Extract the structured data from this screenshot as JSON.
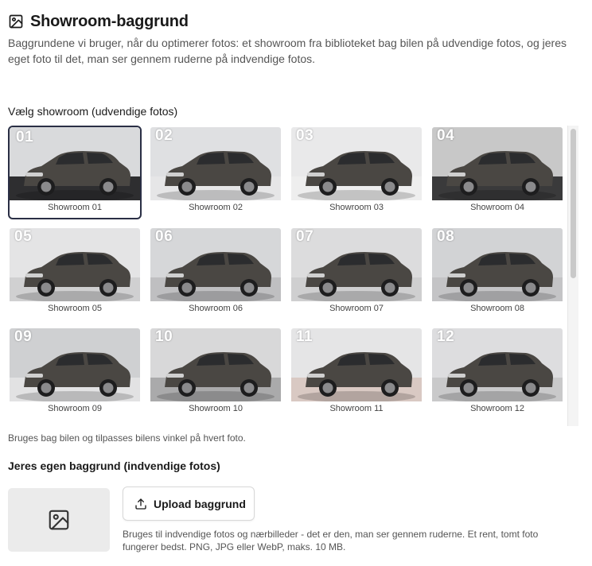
{
  "header": {
    "title": "Showroom-baggrund",
    "description": "Baggrundene vi bruger, når du optimerer fotos: et showroom fra biblioteket bag bilen på udvendige fotos, og jeres eget foto til det, man ser gennem ruderne på indvendige fotos.",
    "icon": "image-icon"
  },
  "showroom_section": {
    "label": "Vælg showroom (udvendige fotos)",
    "selected_index": 0,
    "tiles": [
      {
        "number": "01",
        "caption": "Showroom 01",
        "bg": "#d9dadc",
        "floor": "#2e2e30"
      },
      {
        "number": "02",
        "caption": "Showroom 02",
        "bg": "#dfe0e2",
        "floor": "#e6e6e7"
      },
      {
        "number": "03",
        "caption": "Showroom 03",
        "bg": "#e9e9ea",
        "floor": "#eeeeee"
      },
      {
        "number": "04",
        "caption": "Showroom 04",
        "bg": "#c8c8c8",
        "floor": "#3a3a3b"
      },
      {
        "number": "05",
        "caption": "Showroom 05",
        "bg": "#e4e4e5",
        "floor": "#d0d0d1"
      },
      {
        "number": "06",
        "caption": "Showroom 06",
        "bg": "#d6d7d9",
        "floor": "#bfbfc1"
      },
      {
        "number": "07",
        "caption": "Showroom 07",
        "bg": "#dcdcdd",
        "floor": "#cfcfd0"
      },
      {
        "number": "08",
        "caption": "Showroom 08",
        "bg": "#d2d3d5",
        "floor": "#c4c4c6"
      },
      {
        "number": "09",
        "caption": "Showroom 09",
        "bg": "#cfd0d2",
        "floor": "#e2e2e3"
      },
      {
        "number": "10",
        "caption": "Showroom 10",
        "bg": "#d8d8d9",
        "floor": "#aaaaab"
      },
      {
        "number": "11",
        "caption": "Showroom 11",
        "bg": "#e5e5e6",
        "floor": "#d9c9c3"
      },
      {
        "number": "12",
        "caption": "Showroom 12",
        "bg": "#dddddf",
        "floor": "#c9c9ca"
      }
    ],
    "hint": "Bruges bag bilen og tilpasses bilens vinkel på hvert foto."
  },
  "interior_section": {
    "label": "Jeres egen baggrund (indvendige fotos)",
    "placeholder_icon": "image-placeholder-icon",
    "upload_button_label": "Upload baggrund",
    "upload_icon": "upload-icon",
    "help_text": "Bruges til indvendige fotos og nærbilleder - det er den, man ser gennem ruderne. Et rent, tomt foto fungerer bedst. PNG, JPG eller WebP, maks. 10 MB."
  },
  "colors": {
    "selected_border": "#2a2f45",
    "car_body": "#4a4743"
  }
}
